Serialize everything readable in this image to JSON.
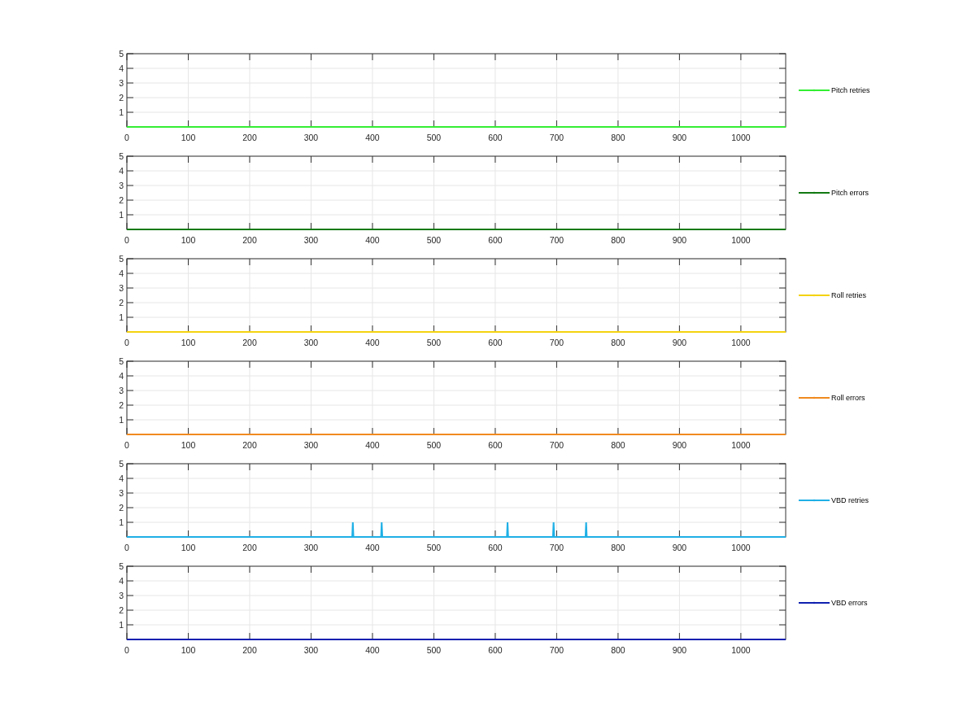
{
  "charts": [
    {
      "chart_data": {
        "type": "line",
        "grid": true,
        "x": [
          0,
          1073
        ],
        "xlim": [
          0,
          1073
        ],
        "ylim": [
          0,
          5
        ],
        "xticks": [
          0,
          100,
          200,
          300,
          400,
          500,
          600,
          700,
          800,
          900,
          1000
        ],
        "yticks": [
          1,
          2,
          3,
          4,
          5
        ],
        "series": [
          {
            "name": "Pitch retries",
            "color": "#33ee33",
            "values": [
              0,
              0
            ]
          }
        ]
      }
    },
    {
      "chart_data": {
        "type": "line",
        "grid": true,
        "x": [
          0,
          1073
        ],
        "xlim": [
          0,
          1073
        ],
        "ylim": [
          0,
          5
        ],
        "xticks": [
          0,
          100,
          200,
          300,
          400,
          500,
          600,
          700,
          800,
          900,
          1000
        ],
        "yticks": [
          1,
          2,
          3,
          4,
          5
        ],
        "series": [
          {
            "name": "Pitch errors",
            "color": "#127a12",
            "values": [
              0,
              0
            ]
          }
        ]
      }
    },
    {
      "chart_data": {
        "type": "line",
        "grid": true,
        "x": [
          0,
          1073
        ],
        "xlim": [
          0,
          1073
        ],
        "ylim": [
          0,
          5
        ],
        "xticks": [
          0,
          100,
          200,
          300,
          400,
          500,
          600,
          700,
          800,
          900,
          1000
        ],
        "yticks": [
          1,
          2,
          3,
          4,
          5
        ],
        "series": [
          {
            "name": "Roll retries",
            "color": "#f5d30f",
            "values": [
              0,
              0
            ]
          }
        ]
      }
    },
    {
      "chart_data": {
        "type": "line",
        "grid": true,
        "x": [
          0,
          1073
        ],
        "xlim": [
          0,
          1073
        ],
        "ylim": [
          0,
          5
        ],
        "xticks": [
          0,
          100,
          200,
          300,
          400,
          500,
          600,
          700,
          800,
          900,
          1000
        ],
        "yticks": [
          1,
          2,
          3,
          4,
          5
        ],
        "series": [
          {
            "name": "Roll errors",
            "color": "#f08a1f",
            "values": [
              0,
              0
            ]
          }
        ]
      }
    },
    {
      "chart_data": {
        "type": "line",
        "grid": true,
        "x": [
          0,
          367,
          368,
          369,
          414,
          415,
          416,
          619,
          620,
          621,
          694,
          695,
          696,
          747,
          748,
          749,
          1073
        ],
        "xlim": [
          0,
          1073
        ],
        "ylim": [
          0,
          5
        ],
        "xticks": [
          0,
          100,
          200,
          300,
          400,
          500,
          600,
          700,
          800,
          900,
          1000
        ],
        "yticks": [
          1,
          2,
          3,
          4,
          5
        ],
        "series": [
          {
            "name": "VBD retries",
            "color": "#1fb0e6",
            "values": [
              0,
              0,
              1,
              0,
              0,
              1,
              0,
              0,
              1,
              0,
              0,
              1,
              0,
              0,
              1,
              0,
              0
            ]
          }
        ]
      }
    },
    {
      "chart_data": {
        "type": "line",
        "grid": true,
        "x": [
          0,
          1073
        ],
        "xlim": [
          0,
          1073
        ],
        "ylim": [
          0,
          5
        ],
        "xticks": [
          0,
          100,
          200,
          300,
          400,
          500,
          600,
          700,
          800,
          900,
          1000
        ],
        "yticks": [
          1,
          2,
          3,
          4,
          5
        ],
        "series": [
          {
            "name": "VBD errors",
            "color": "#1020b0",
            "values": [
              0,
              0
            ]
          }
        ]
      }
    }
  ]
}
